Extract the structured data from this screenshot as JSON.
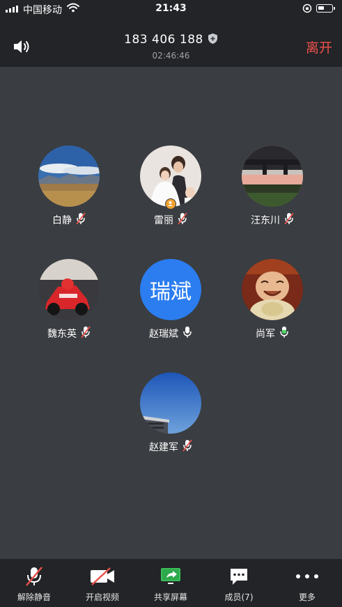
{
  "status_bar": {
    "carrier": "中国移动",
    "time": "21:43"
  },
  "header": {
    "meeting_id": "183 406 188",
    "duration": "02:46:46",
    "leave_label": "离开"
  },
  "participants": [
    {
      "name": "白静",
      "mic": "muted",
      "avatar": "photo-mountains"
    },
    {
      "name": "雷丽",
      "mic": "muted",
      "avatar": "photo-wedding",
      "host": true
    },
    {
      "name": "汪东川",
      "mic": "muted",
      "avatar": "photo-sunset-bridge"
    },
    {
      "name": "魏东英",
      "mic": "muted",
      "avatar": "photo-racing"
    },
    {
      "name": "赵瑞斌",
      "mic": "on",
      "avatar": "initials",
      "initials": "瑞斌"
    },
    {
      "name": "尚军",
      "mic": "speaking",
      "avatar": "photo-buddha"
    },
    {
      "name": "赵建军",
      "mic": "muted",
      "avatar": "photo-sky-building"
    }
  ],
  "toolbar": {
    "unmute": "解除静音",
    "start_video": "开启视频",
    "share_screen": "共享屏幕",
    "members": "成员(7)",
    "more": "更多"
  },
  "colors": {
    "accent_blue": "#2b7df0",
    "leave_red": "#f0504a",
    "mute_red": "#e8504a",
    "speaking_green": "#4cd964",
    "share_green": "#3bbf5a"
  }
}
